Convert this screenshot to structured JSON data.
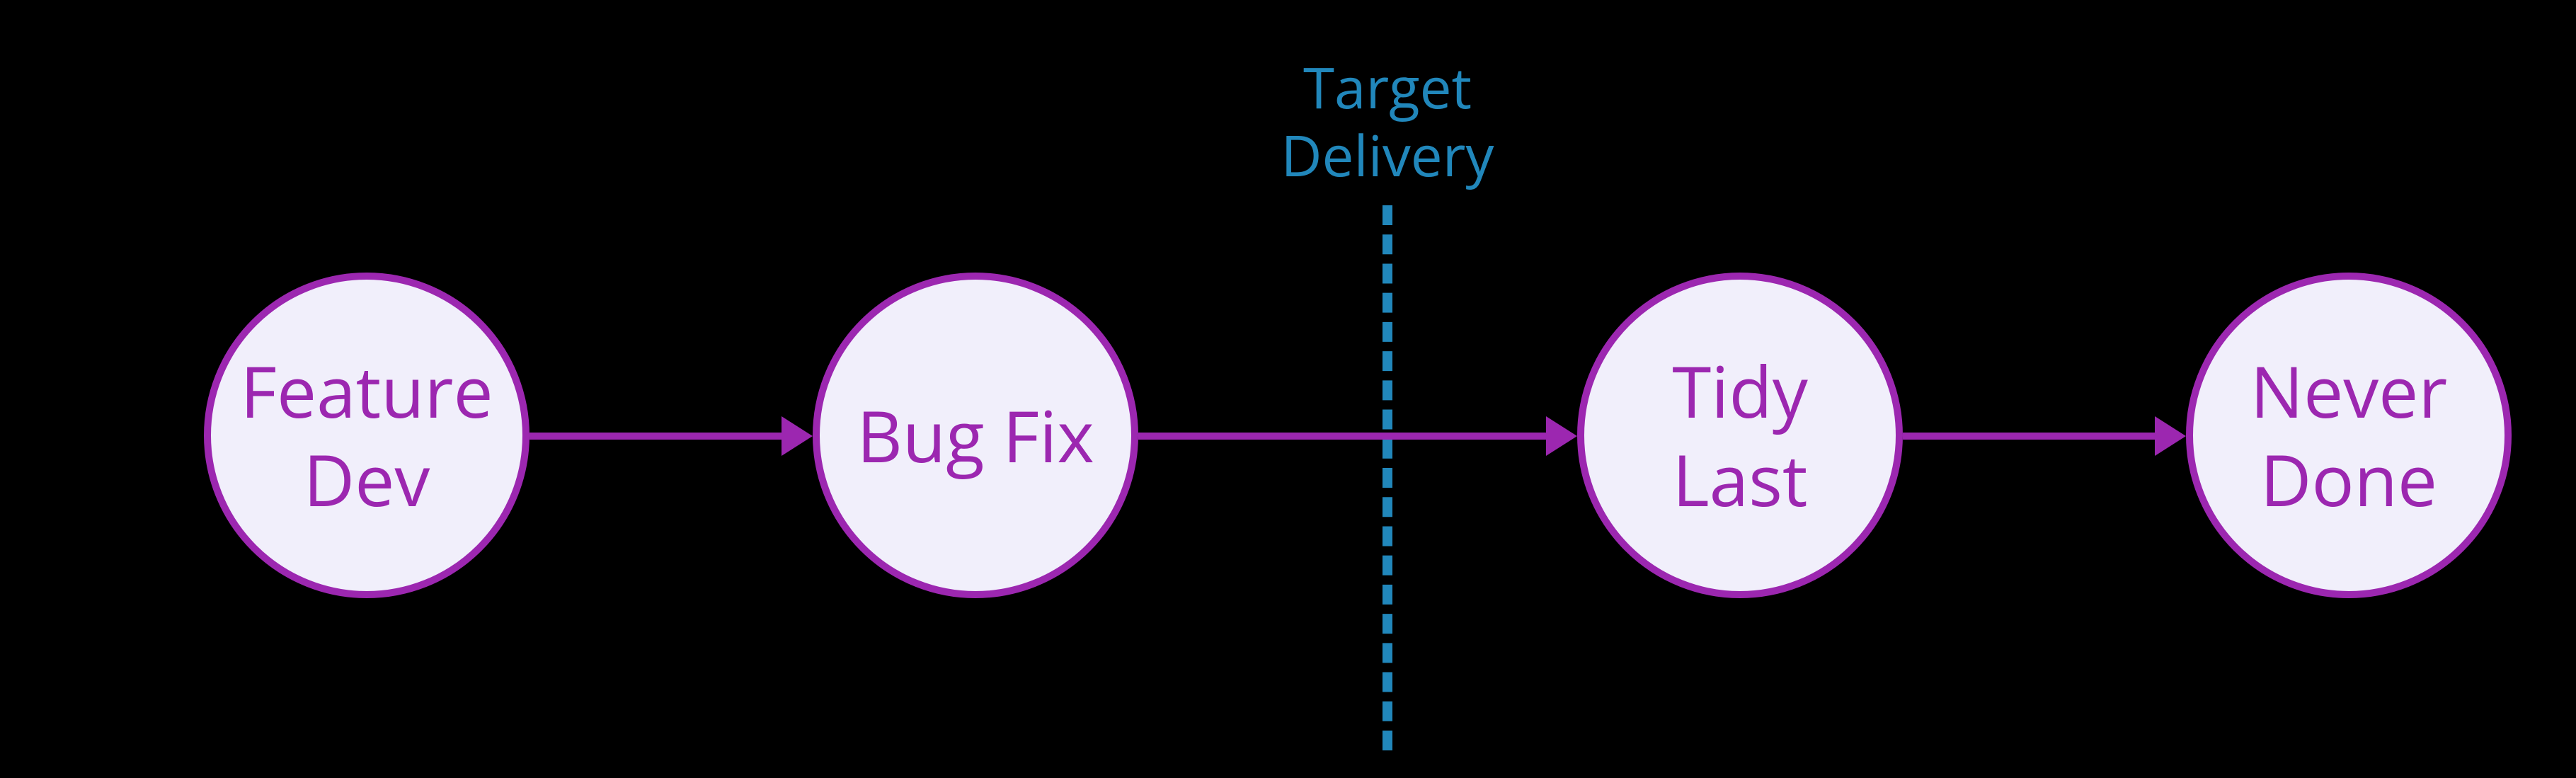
{
  "diagram": {
    "nodes": [
      {
        "line1": "Feature",
        "line2": "Dev"
      },
      {
        "line1": "Bug Fix",
        "line2": ""
      },
      {
        "line1": "Tidy",
        "line2": "Last"
      },
      {
        "line1": "Never",
        "line2": "Done"
      }
    ],
    "divider": {
      "line1": "Target",
      "line2": "Delivery"
    },
    "colors": {
      "node_fill": "#F1EFFB",
      "node_stroke": "#9C27B0",
      "node_text": "#9C27B0",
      "arrow": "#9C27B0",
      "divider": "#2187BB",
      "background": "#000000"
    }
  }
}
